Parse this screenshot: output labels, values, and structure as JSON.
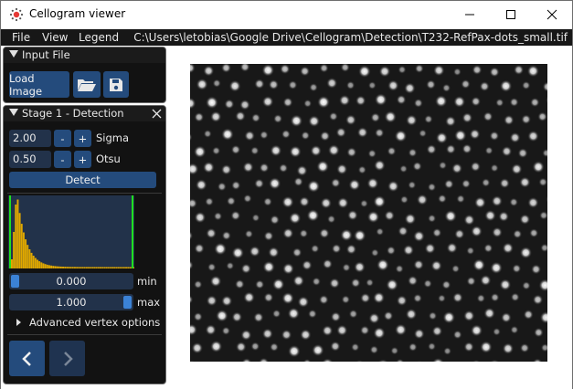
{
  "window": {
    "title": "Cellogram viewer",
    "minimize_icon": "minimize-icon",
    "maximize_icon": "maximize-icon",
    "close_icon": "close-icon"
  },
  "menu": {
    "file": "File",
    "view": "View",
    "legend": "Legend",
    "path": "C:\\Users\\letobias\\Google Drive\\Cellogram\\Detection\\T232-RefPax-dots_small.tif"
  },
  "input_file": {
    "title": "Input File",
    "load_label": "Load Image",
    "open_icon": "folder-open-icon",
    "save_icon": "save-icon"
  },
  "detection": {
    "title": "Stage 1 - Detection",
    "sigma_value": "2.00",
    "sigma_label": "Sigma",
    "otsu_value": "0.50",
    "otsu_label": "Otsu",
    "minus": "-",
    "plus": "+",
    "detect_label": "Detect",
    "min_value": "0.000",
    "min_label": "min",
    "max_value": "1.000",
    "max_label": "max",
    "advanced_label": "Advanced vertex options",
    "prev_icon": "chevron-left-icon",
    "next_icon": "chevron-right-icon"
  },
  "colors": {
    "accent": "#244b7c",
    "histogram_bar": "#e0a800",
    "threshold_line": "#1fe01f",
    "panel_bg": "#121212"
  }
}
